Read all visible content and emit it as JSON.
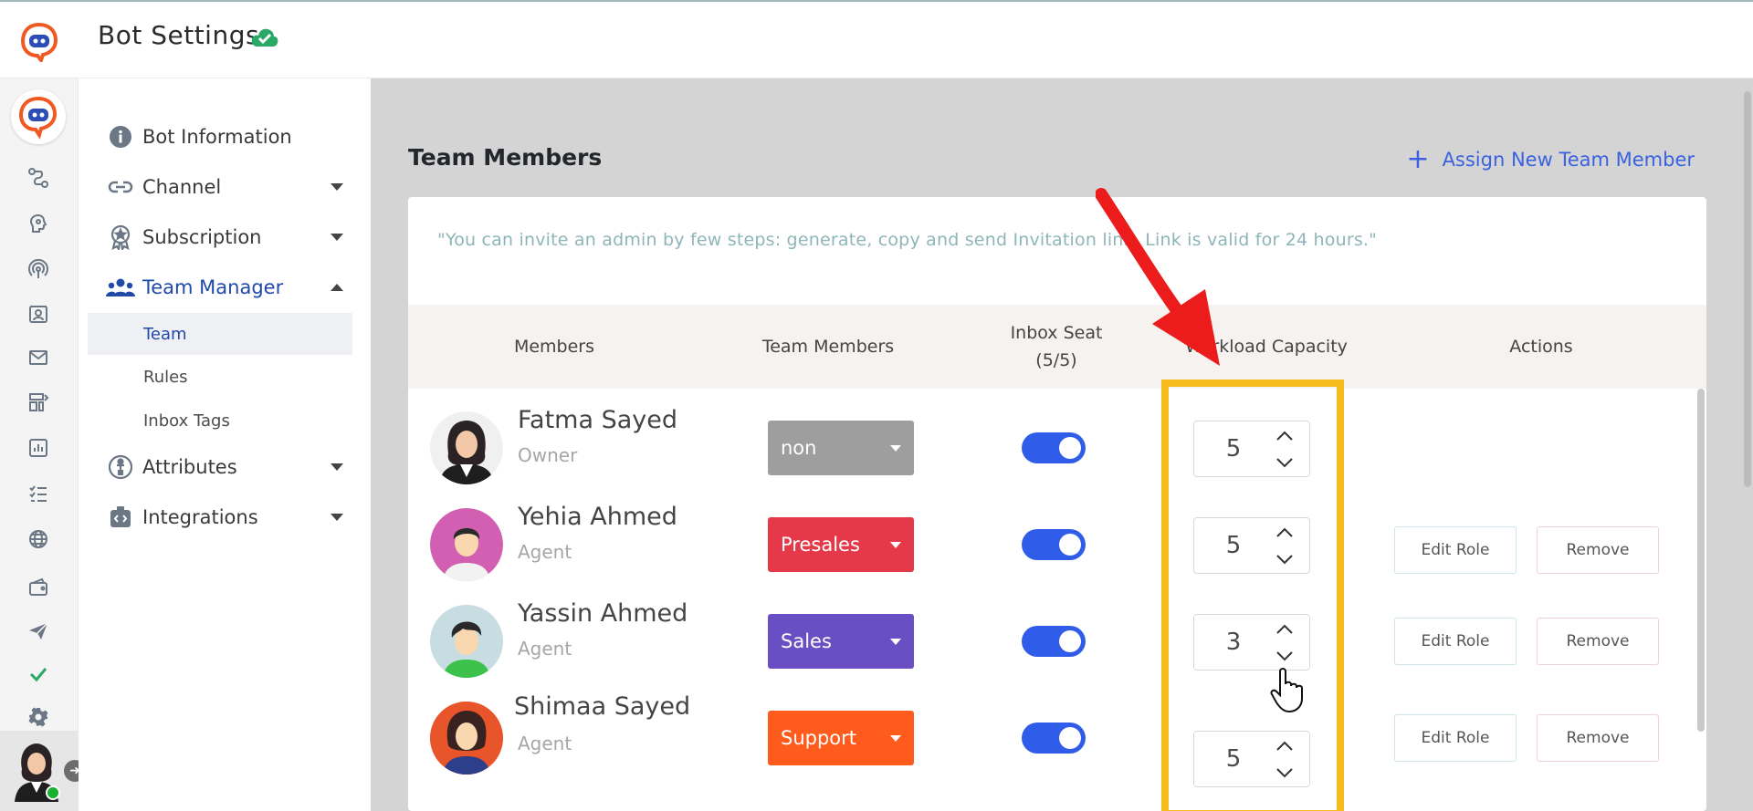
{
  "header": {
    "title": "Bot Settings"
  },
  "sidebar_nav": {
    "items": [
      {
        "label": "Bot Information",
        "icon": "info-icon"
      },
      {
        "label": "Channel",
        "icon": "link-icon"
      },
      {
        "label": "Subscription",
        "icon": "badge-icon"
      },
      {
        "label": "Team Manager",
        "icon": "team-icon"
      },
      {
        "label": "Attributes",
        "icon": "person-icon"
      },
      {
        "label": "Integrations",
        "icon": "integrations-icon"
      }
    ],
    "sub_items": [
      {
        "label": "Team"
      },
      {
        "label": "Rules"
      },
      {
        "label": "Inbox Tags"
      }
    ]
  },
  "main": {
    "section_title": "Team Members",
    "assign_label": "Assign New Team Member",
    "info_text": "\"You can invite an admin by few steps: generate, copy and send Invitation link. Link is valid for 24 hours.\"",
    "columns": {
      "members": "Members",
      "team_members": "Team Members",
      "inbox_seat_line1": "Inbox Seat",
      "inbox_seat_line2": "(5/5)",
      "workload": "Workload Capacity",
      "actions": "Actions"
    },
    "rows": [
      {
        "name": "Fatma Sayed",
        "role": "Owner",
        "team": "non",
        "team_color": "#9e9e9e",
        "seat_on": true,
        "workload": "5",
        "edit_label": "",
        "remove_label": ""
      },
      {
        "name": "Yehia Ahmed",
        "role": "Agent",
        "team": "Presales",
        "team_color": "#e5394a",
        "seat_on": true,
        "workload": "5",
        "edit_label": "Edit Role",
        "remove_label": "Remove"
      },
      {
        "name": "Yassin Ahmed",
        "role": "Agent",
        "team": "Sales",
        "team_color": "#6a4fc4",
        "seat_on": true,
        "workload": "3",
        "edit_label": "Edit Role",
        "remove_label": "Remove"
      },
      {
        "name": "Shimaa Sayed",
        "role": "Agent",
        "team": "Support",
        "team_color": "#fe5b1c",
        "seat_on": true,
        "workload": "5",
        "edit_label": "Edit Role",
        "remove_label": "Remove"
      }
    ]
  },
  "colors": {
    "accent_blue": "#2f5ce8",
    "highlight": "#f8bb1c",
    "arrow": "#ec1c1c"
  }
}
